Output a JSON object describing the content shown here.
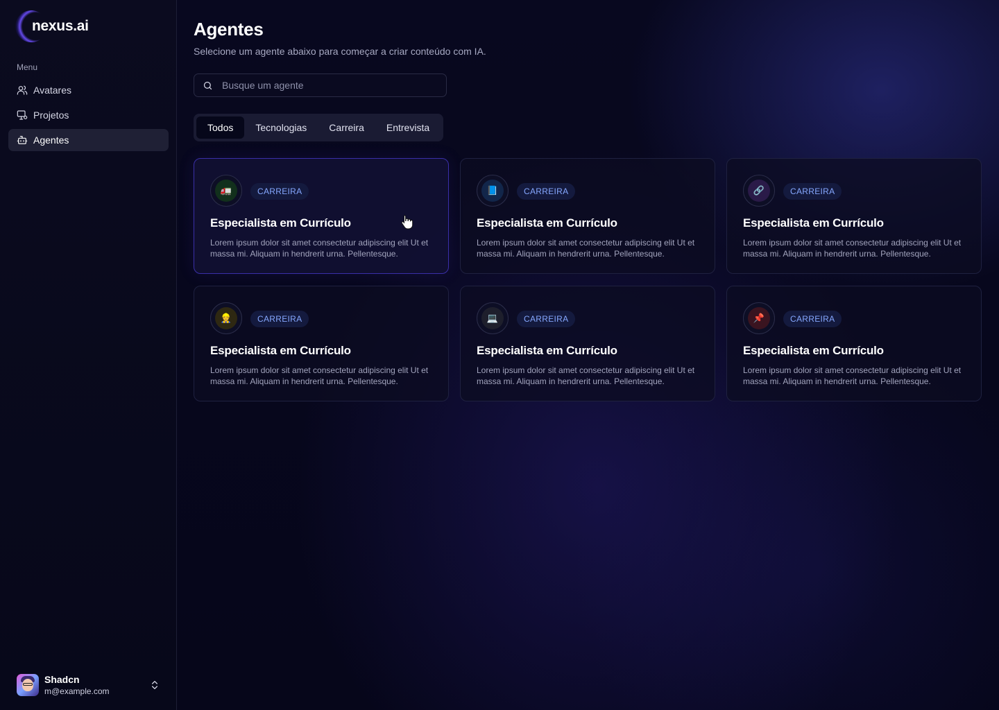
{
  "app": {
    "logo": "nexus.ai"
  },
  "sidebar": {
    "menu_label": "Menu",
    "items": [
      {
        "label": "Avatares",
        "icon": "users-icon",
        "active": false
      },
      {
        "label": "Projetos",
        "icon": "monitor-icon",
        "active": false
      },
      {
        "label": "Agentes",
        "icon": "bot-icon",
        "active": true
      }
    ]
  },
  "user": {
    "name": "Shadcn",
    "email": "m@example.com"
  },
  "header": {
    "title": "Agentes",
    "subtitle": "Selecione um agente abaixo para começar a criar conteúdo com IA."
  },
  "search": {
    "placeholder": "Busque um agente"
  },
  "tabs": [
    {
      "label": "Todos",
      "active": true
    },
    {
      "label": "Tecnologias",
      "active": false
    },
    {
      "label": "Carreira",
      "active": false
    },
    {
      "label": "Entrevista",
      "active": false
    }
  ],
  "cards": [
    {
      "badge": "CARREIRA",
      "title": "Especialista em Currículo",
      "desc": "Lorem ipsum dolor sit amet consectetur adipiscing elit Ut et massa mi. Aliquam in hendrerit urna. Pellentesque.",
      "icon": "truck-icon",
      "glyph": "🚛",
      "tint": "#12301c"
    },
    {
      "badge": "CARREIRA",
      "title": "Especialista em Currículo",
      "desc": "Lorem ipsum dolor sit amet consectetur adipiscing elit Ut et massa mi. Aliquam in hendrerit urna. Pellentesque.",
      "icon": "book-icon",
      "glyph": "📘",
      "tint": "#12264a"
    },
    {
      "badge": "CARREIRA",
      "title": "Especialista em Currículo",
      "desc": "Lorem ipsum dolor sit amet consectetur adipiscing elit Ut et massa mi. Aliquam in hendrerit urna. Pellentesque.",
      "icon": "link-icon",
      "glyph": "🔗",
      "tint": "#2a1a48"
    },
    {
      "badge": "CARREIRA",
      "title": "Especialista em Currículo",
      "desc": "Lorem ipsum dolor sit amet consectetur adipiscing elit Ut et massa mi. Aliquam in hendrerit urna. Pellentesque.",
      "icon": "worker-icon",
      "glyph": "👷",
      "tint": "#2e2812"
    },
    {
      "badge": "CARREIRA",
      "title": "Especialista em Currículo",
      "desc": "Lorem ipsum dolor sit amet consectetur adipiscing elit Ut et massa mi. Aliquam in hendrerit urna. Pellentesque.",
      "icon": "laptop-icon",
      "glyph": "💻",
      "tint": "#1e1f2c"
    },
    {
      "badge": "CARREIRA",
      "title": "Especialista em Currículo",
      "desc": "Lorem ipsum dolor sit amet consectetur adipiscing elit Ut et massa mi. Aliquam in hendrerit urna. Pellentesque.",
      "icon": "pushpin-icon",
      "glyph": "📌",
      "tint": "#3a1420"
    }
  ],
  "colors": {
    "accent": "#86a8ff",
    "background": "#06061a",
    "highlight_border": "#3a2fa8"
  }
}
